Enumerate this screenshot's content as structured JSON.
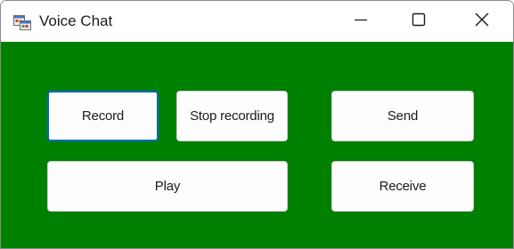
{
  "window": {
    "title": "Voice Chat",
    "icon": "app-form-icon"
  },
  "caption_buttons": {
    "minimize": "minimize-icon",
    "maximize": "maximize-icon",
    "close": "close-icon"
  },
  "colors": {
    "client_background": "#008000",
    "focus_border": "#0067c0"
  },
  "buttons": {
    "record": "Record",
    "stop_recording": "Stop recording",
    "send": "Send",
    "play": "Play",
    "receive": "Receive"
  }
}
